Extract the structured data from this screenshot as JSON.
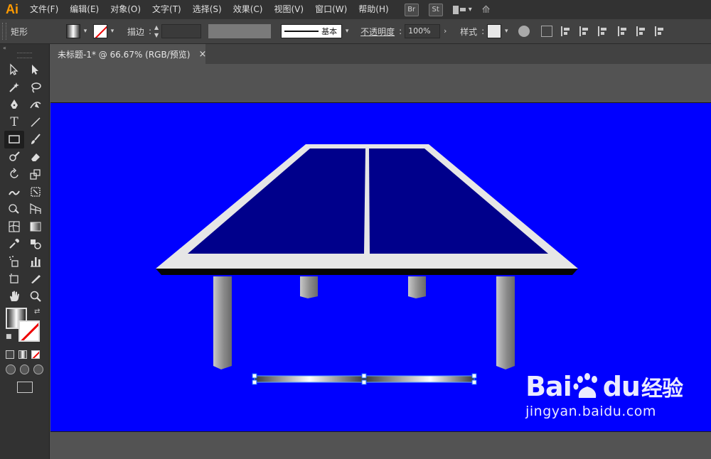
{
  "app": {
    "logo": "Ai",
    "menu": [
      "文件(F)",
      "编辑(E)",
      "对象(O)",
      "文字(T)",
      "选择(S)",
      "效果(C)",
      "视图(V)",
      "窗口(W)",
      "帮助(H)"
    ],
    "bridge_label": "Br",
    "stock_label": "St"
  },
  "controlbar": {
    "object_type": "矩形",
    "stroke_label": "描边",
    "brush_label": "基本",
    "opacity_label": "不透明度",
    "opacity_value": "100%",
    "style_label": "样式"
  },
  "document": {
    "tab_title": "未标题-1* @ 66.67% (RGB/预览)",
    "close_glyph": "×"
  },
  "colors": {
    "artboard": "#0000ff",
    "table_top": "#00008b",
    "table_border": "#e6e6e6",
    "ui_dark": "#323232",
    "ui_mid": "#424242",
    "ui_canvas": "#535353"
  },
  "watermark": {
    "brand": "Bai",
    "brand_tail": "du",
    "cn": "经验",
    "url": "jingyan.baidu.com"
  }
}
